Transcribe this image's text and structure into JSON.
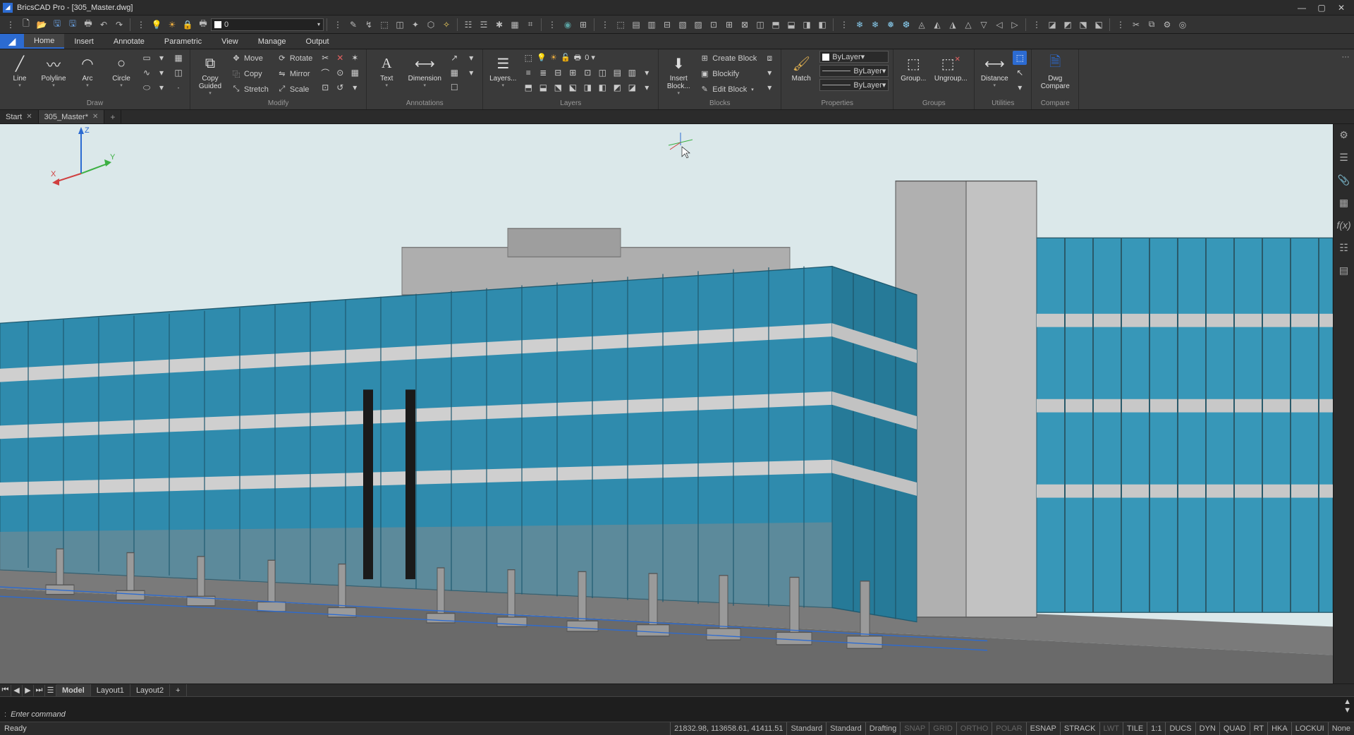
{
  "app": {
    "title": "BricsCAD Pro - [305_Master.dwg]"
  },
  "qat_layer": "0",
  "ribbon": {
    "tabs": [
      "Home",
      "Insert",
      "Annotate",
      "Parametric",
      "View",
      "Manage",
      "Output"
    ],
    "active": "Home",
    "panels": {
      "draw": {
        "label": "Draw",
        "line": "Line",
        "polyline": "Polyline",
        "arc": "Arc",
        "circle": "Circle"
      },
      "modify": {
        "label": "Modify",
        "copyguided": "Copy Guided",
        "move": "Move",
        "copy": "Copy",
        "stretch": "Stretch",
        "rotate": "Rotate",
        "mirror": "Mirror",
        "scale": "Scale"
      },
      "annotations": {
        "label": "Annotations",
        "text": "Text",
        "dimension": "Dimension"
      },
      "layers": {
        "label": "Layers",
        "layers": "Layers...",
        "combo": "0"
      },
      "blocks": {
        "label": "Blocks",
        "insert": "Insert Block...",
        "create": "Create Block",
        "blockify": "Blockify",
        "edit": "Edit Block"
      },
      "properties": {
        "label": "Properties",
        "match": "Match",
        "bylayer": "ByLayer"
      },
      "groups": {
        "label": "Groups",
        "group": "Group...",
        "ungroup": "Ungroup..."
      },
      "utilities": {
        "label": "Utilities",
        "distance": "Distance"
      },
      "compare": {
        "label": "Compare",
        "dwg": "Dwg Compare"
      }
    }
  },
  "doctabs": {
    "start": "Start",
    "file": "305_Master*"
  },
  "layout": {
    "model": "Model",
    "l1": "Layout1",
    "l2": "Layout2"
  },
  "cmd": {
    "prompt": ":",
    "placeholder": "Enter command"
  },
  "status": {
    "ready": "Ready",
    "coords": "21832.98, 113658.61, 41411.51",
    "std1": "Standard",
    "std2": "Standard",
    "drafting": "Drafting",
    "toggles": [
      "SNAP",
      "GRID",
      "ORTHO",
      "POLAR",
      "ESNAP",
      "STRACK",
      "LWT",
      "TILE",
      "1:1",
      "DUCS",
      "DYN",
      "QUAD",
      "RT",
      "HKA",
      "LOCKUI",
      "None"
    ],
    "on": [
      "ESNAP",
      "STRACK",
      "TILE",
      "1:1",
      "DUCS",
      "DYN",
      "QUAD",
      "RT",
      "HKA",
      "LOCKUI",
      "None"
    ]
  }
}
